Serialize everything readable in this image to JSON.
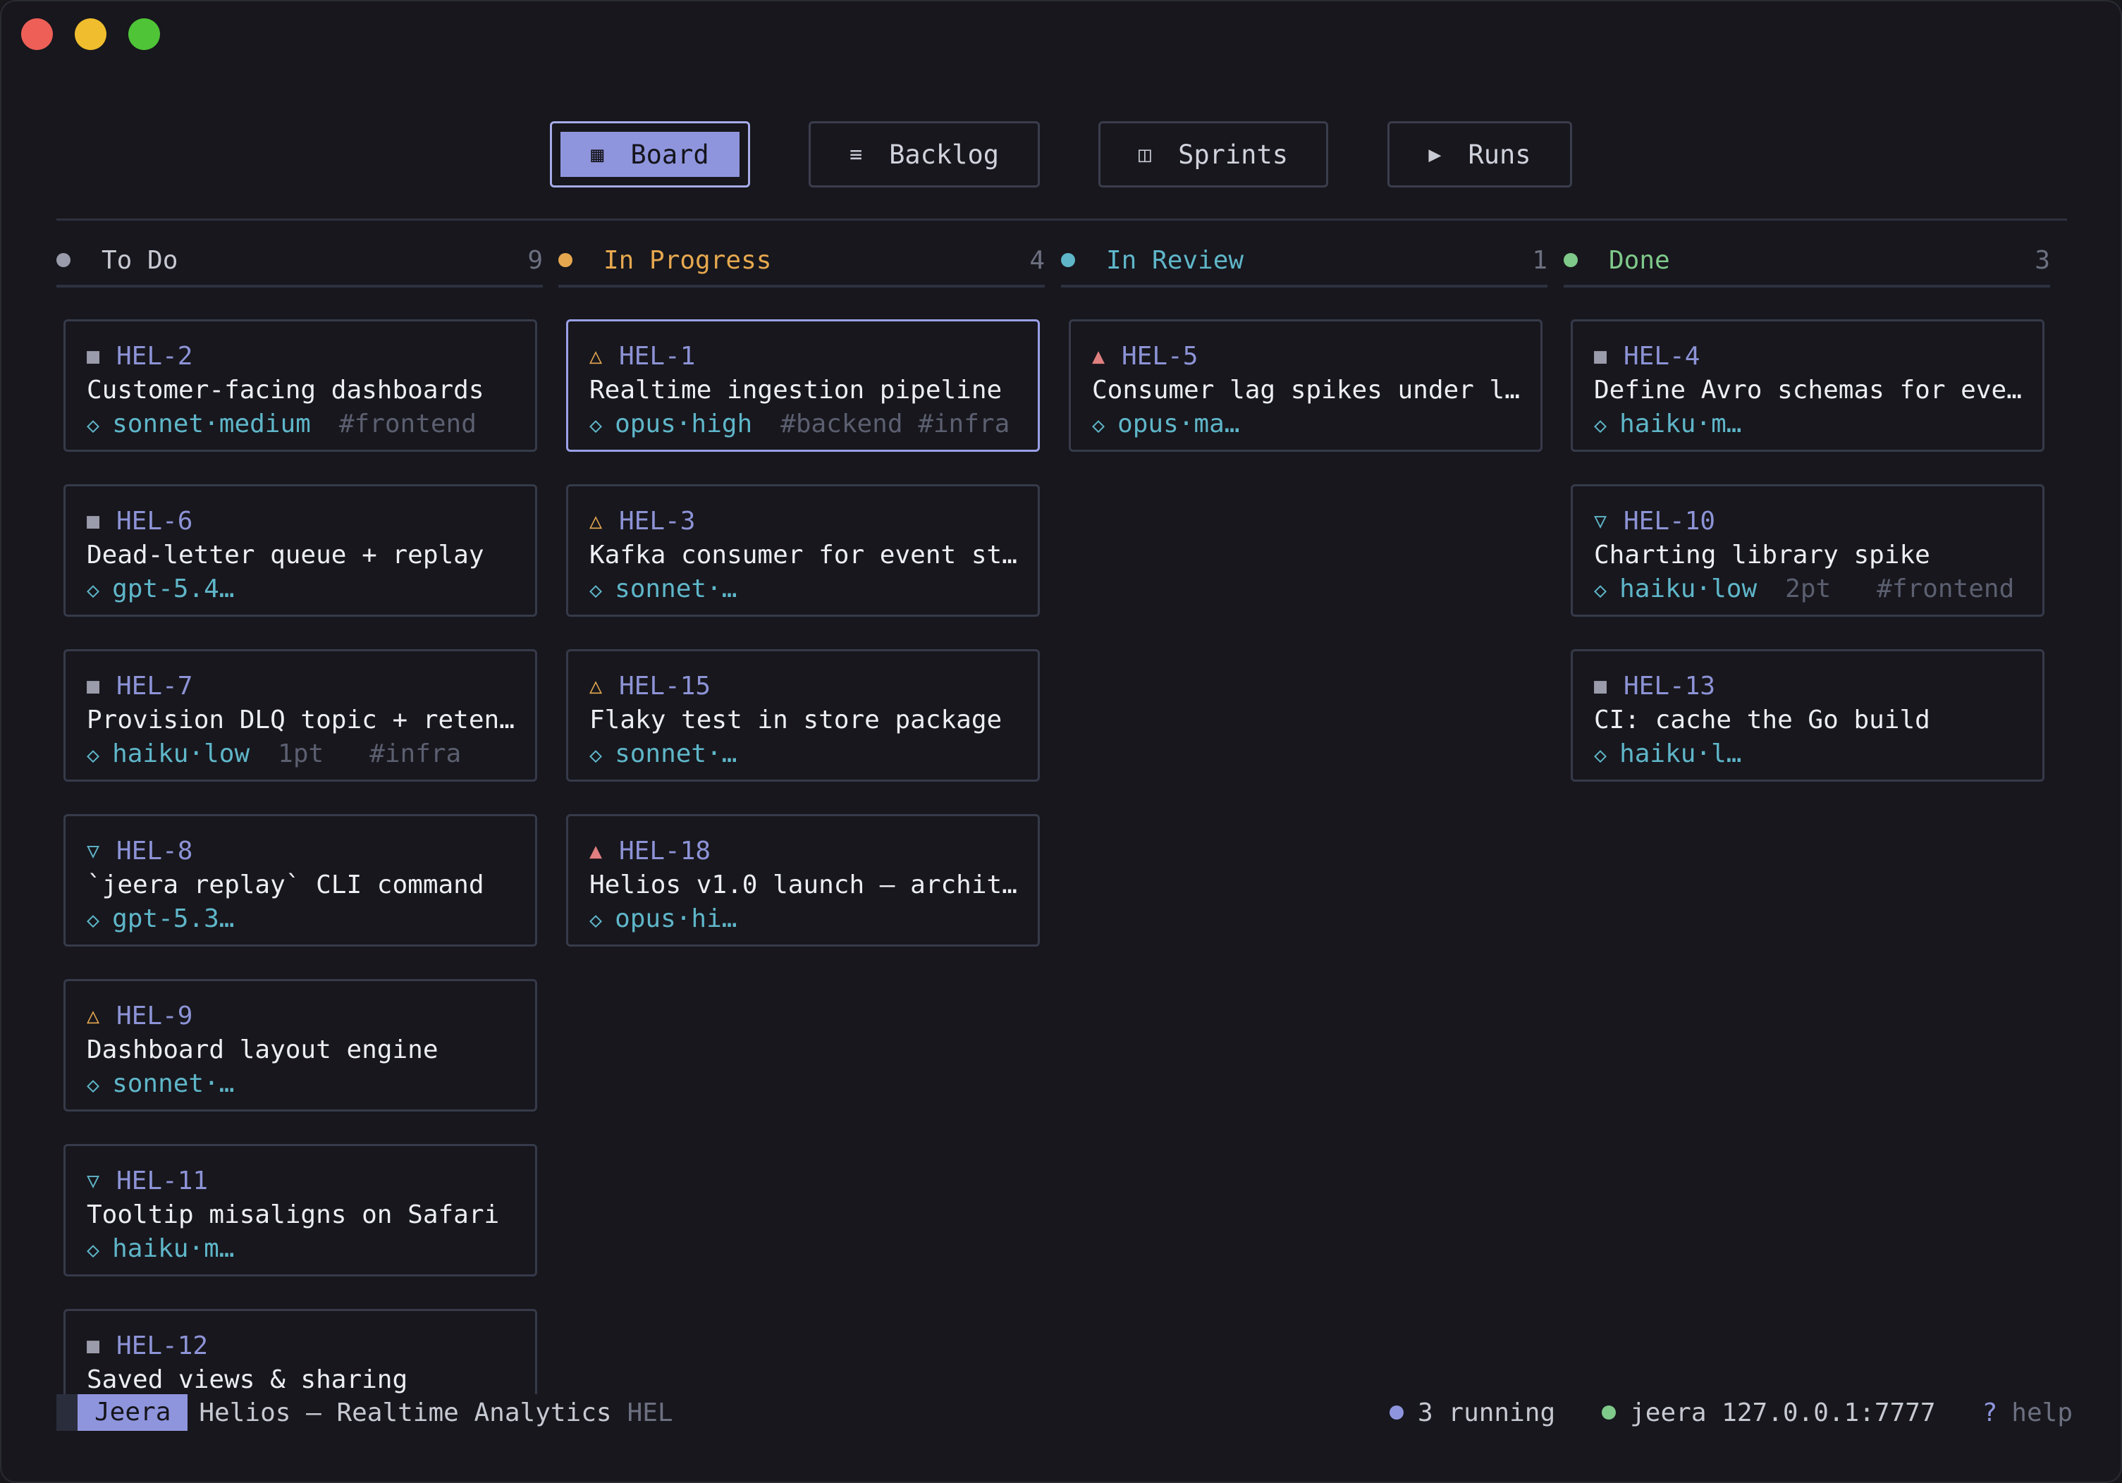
{
  "window": {
    "controls": [
      "close",
      "minimize",
      "zoom"
    ]
  },
  "tabs": [
    {
      "icon": "board-icon",
      "glyph": "▦",
      "label": "Board",
      "active": true
    },
    {
      "icon": "list-icon",
      "glyph": "≡",
      "label": "Backlog",
      "active": false
    },
    {
      "icon": "sprints-icon",
      "glyph": "◫",
      "label": "Sprints",
      "active": false
    },
    {
      "icon": "play-icon",
      "glyph": "▶",
      "label": "Runs",
      "active": false
    }
  ],
  "columns": [
    {
      "title": "To Do",
      "count": "9",
      "color": "#9a9cab",
      "cards": [
        {
          "priority": "■",
          "pcolor": "#9a9cab",
          "id": "HEL-2",
          "title": "Customer-facing dashboards",
          "model": "sonnet·medium",
          "extra": "#frontend"
        },
        {
          "priority": "■",
          "pcolor": "#9a9cab",
          "id": "HEL-6",
          "title": "Dead-letter queue + replay",
          "model": "gpt-5.4…",
          "extra": ""
        },
        {
          "priority": "■",
          "pcolor": "#9a9cab",
          "id": "HEL-7",
          "title": "Provision DLQ topic + reten…",
          "model": "haiku·low",
          "extra": "1pt   #infra"
        },
        {
          "priority": "▽",
          "pcolor": "#5fb6c9",
          "id": "HEL-8",
          "title": "`jeera replay` CLI command",
          "model": "gpt-5.3…",
          "extra": ""
        },
        {
          "priority": "△",
          "pcolor": "#e6a84f",
          "id": "HEL-9",
          "title": "Dashboard layout engine",
          "model": "sonnet·…",
          "extra": ""
        },
        {
          "priority": "▽",
          "pcolor": "#5fb6c9",
          "id": "HEL-11",
          "title": "Tooltip misaligns on Safari",
          "model": "haiku·m…",
          "extra": ""
        },
        {
          "priority": "■",
          "pcolor": "#9a9cab",
          "id": "HEL-12",
          "title": "Saved views & sharing",
          "model": "",
          "extra": ""
        }
      ]
    },
    {
      "title": "In Progress",
      "count": "4",
      "color": "#e6a84f",
      "cards": [
        {
          "priority": "△",
          "pcolor": "#e6a84f",
          "id": "HEL-1",
          "title": "Realtime ingestion pipeline",
          "model": "opus·high",
          "extra": "#backend #infra",
          "selected": true
        },
        {
          "priority": "△",
          "pcolor": "#e6a84f",
          "id": "HEL-3",
          "title": "Kafka consumer for event st…",
          "model": "sonnet·…",
          "extra": ""
        },
        {
          "priority": "△",
          "pcolor": "#e6a84f",
          "id": "HEL-15",
          "title": "Flaky test in store package",
          "model": "sonnet·…",
          "extra": ""
        },
        {
          "priority": "▲",
          "pcolor": "#e07f7f",
          "id": "HEL-18",
          "title": "Helios v1.0 launch — archit…",
          "model": "opus·hi…",
          "extra": ""
        }
      ]
    },
    {
      "title": "In Review",
      "count": "1",
      "color": "#5fb6c9",
      "cards": [
        {
          "priority": "▲",
          "pcolor": "#e07f7f",
          "id": "HEL-5",
          "title": "Consumer lag spikes under l…",
          "model": "opus·ma…",
          "extra": ""
        }
      ]
    },
    {
      "title": "Done",
      "count": "3",
      "color": "#7fc98a",
      "cards": [
        {
          "priority": "■",
          "pcolor": "#9a9cab",
          "id": "HEL-4",
          "title": "Define Avro schemas for eve…",
          "model": "haiku·m…",
          "extra": ""
        },
        {
          "priority": "▽",
          "pcolor": "#5fb6c9",
          "id": "HEL-10",
          "title": "Charting library spike",
          "model": "haiku·low",
          "extra": "2pt   #frontend"
        },
        {
          "priority": "■",
          "pcolor": "#9a9cab",
          "id": "HEL-13",
          "title": "CI: cache the Go build",
          "model": "haiku·l…",
          "extra": ""
        }
      ]
    }
  ],
  "status": {
    "app": "Jeera",
    "project": "Helios — Realtime Analytics",
    "key": "HEL",
    "running": "3 running",
    "running_color": "#8f95dd",
    "server": "jeera 127.0.0.1:7777",
    "server_color": "#7fc98a",
    "help_key": "?",
    "help_label": "help"
  }
}
